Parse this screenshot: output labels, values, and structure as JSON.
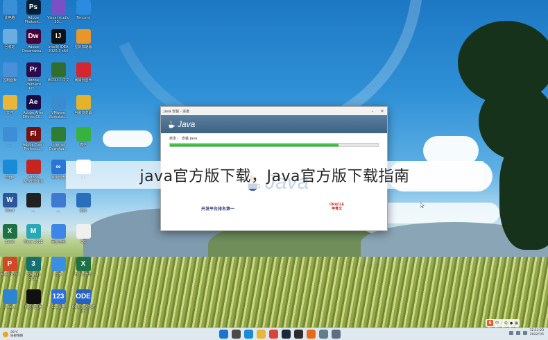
{
  "desktop": {
    "icons": [
      {
        "label": "此电脑",
        "glyph": "",
        "color": "#3a8fd6"
      },
      {
        "label": "Adobe Photosh...",
        "glyph": "Ps",
        "color": "#001e36"
      },
      {
        "label": "Visual studio 20...",
        "glyph": "",
        "color": "#7b4fc6"
      },
      {
        "label": "Tencent",
        "glyph": "",
        "color": "#2a8be0"
      },
      {
        "label": "回收站",
        "glyph": "",
        "color": "#6aaee0"
      },
      {
        "label": "Adobe Dreamwea...",
        "glyph": "Dw",
        "color": "#470137"
      },
      {
        "label": "IntelliJ IDEA 2020.3 x64",
        "glyph": "IJ",
        "color": "#111111"
      },
      {
        "label": "星际加速器",
        "glyph": "",
        "color": "#e8962b"
      },
      {
        "label": "控制面板",
        "glyph": "",
        "color": "#4a90d9"
      },
      {
        "label": "Adobe Premiere Pro...",
        "glyph": "Pr",
        "color": "#2a0b4c"
      },
      {
        "label": "MCDR... 中文",
        "glyph": "",
        "color": "#2f6e2f"
      },
      {
        "label": "网易云音乐",
        "glyph": "",
        "color": "#d3262f"
      },
      {
        "label": "文件",
        "glyph": "",
        "color": "#e8b73a"
      },
      {
        "label": "Adobe After Effects CC...",
        "glyph": "Ae",
        "color": "#1a0b44"
      },
      {
        "label": "VMware Workstati...",
        "glyph": "",
        "color": "#3b8bd0"
      },
      {
        "label": "谷歌浏览器",
        "glyph": "",
        "color": "#e5b22b"
      },
      {
        "label": "...",
        "glyph": "",
        "color": "#3d8ed6"
      },
      {
        "label": "Adobe Flash Professio...",
        "glyph": "Fl",
        "color": "#7a1111"
      },
      {
        "label": "Internet Downloa...",
        "glyph": "",
        "color": "#2e7d32"
      },
      {
        "label": "微信",
        "glyph": "",
        "color": "#35b33c"
      },
      {
        "label": "Edge",
        "glyph": "",
        "color": "#1a8bd6"
      },
      {
        "label": "Adobe Acrobat DC",
        "glyph": "",
        "color": "#c6241f"
      },
      {
        "label": "百度网盘",
        "glyph": "∞",
        "color": "#2a75d8"
      },
      {
        "label": "QQ",
        "glyph": "",
        "color": "#ffffff"
      },
      {
        "label": "Word",
        "glyph": "W",
        "color": "#2b579a"
      },
      {
        "label": "...",
        "glyph": "",
        "color": "#222222"
      },
      {
        "label": "...",
        "glyph": "",
        "color": "#3f79d1"
      },
      {
        "label": "指纹",
        "glyph": "",
        "color": "#2a6fba"
      },
      {
        "label": "Excel",
        "glyph": "X",
        "color": "#1e7145"
      },
      {
        "label": "Maya 2022",
        "glyph": "M",
        "color": "#2aa8b8"
      },
      {
        "label": "百度地图",
        "glyph": "",
        "color": "#3d85e6"
      },
      {
        "label": "GG",
        "glyph": "",
        "color": "#f0f0f0"
      },
      {
        "label": "PowerPoint",
        "glyph": "P",
        "color": "#d24726"
      },
      {
        "label": "3ds Max 2021",
        "glyph": "3",
        "color": "#15706f"
      },
      {
        "label": "云盘",
        "glyph": "",
        "color": "#3a8fe0"
      },
      {
        "label": "Excel 表单",
        "glyph": "X",
        "color": "#1e7145"
      },
      {
        "label": "...Web...",
        "glyph": "",
        "color": "#2c84d2"
      },
      {
        "label": "剪映专业版",
        "glyph": "",
        "color": "#111111"
      },
      {
        "label": "123云盘",
        "glyph": "123",
        "color": "#2a6ee0"
      },
      {
        "label": "ODE 多功能助手",
        "glyph": "ODE",
        "color": "#2561c4"
      }
    ]
  },
  "installer": {
    "title": "Java 安装 - 进度",
    "banner_logo": "Java",
    "status_label": "状态：",
    "status_text": "安装 Java",
    "progress": 0.81,
    "big_logo": "Java",
    "footer_text": "开发平台排名第一",
    "oracle_line1": "ORACLE",
    "oracle_line2": "甲骨文"
  },
  "headline": "java官方版下载，Java官方版下载指南",
  "taskbar": {
    "weather_temp": "28°C",
    "weather_desc": "局部晴朗",
    "clock_time": "12:11:23",
    "clock_date": "2022/7/5",
    "apps": [
      {
        "name": "start",
        "color": "#1b75d0"
      },
      {
        "name": "search",
        "color": "#4a4a4a"
      },
      {
        "name": "edge",
        "color": "#1a8bd6"
      },
      {
        "name": "explorer",
        "color": "#e8b73a"
      },
      {
        "name": "chrome",
        "color": "#d9453a"
      },
      {
        "name": "steam",
        "color": "#1b2838"
      },
      {
        "name": "terminal",
        "color": "#2d2d2d"
      },
      {
        "name": "java",
        "color": "#e86a17"
      },
      {
        "name": "vmware",
        "color": "#607d8b"
      },
      {
        "name": "settings",
        "color": "#5a6f84"
      }
    ]
  },
  "ime": {
    "logo": "S",
    "mode": "中"
  }
}
